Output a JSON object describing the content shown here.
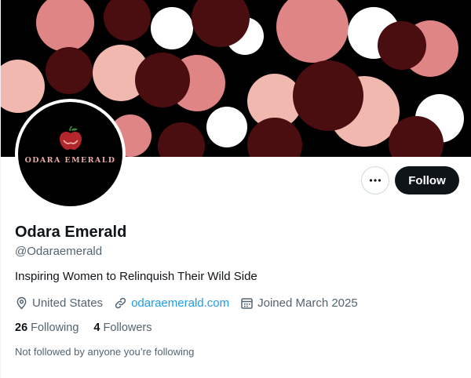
{
  "profile": {
    "display_name": "Odara Emerald",
    "handle": "@Odaraemerald",
    "bio": "Inspiring Women to Relinquish Their Wild Side",
    "avatar_text": "ODARA EMERALD",
    "location": "United States",
    "website": "odaraemerald.com",
    "joined": "Joined March 2025",
    "following_count": "26",
    "following_label": "Following",
    "followers_count": "4",
    "followers_label": "Followers",
    "social_note": "Not followed by anyone you’re following"
  },
  "actions": {
    "follow_label": "Follow",
    "more_icon": "more-horizontal-icon"
  },
  "icons": {
    "location": "location-pin-icon",
    "website": "link-icon",
    "joined": "calendar-icon"
  },
  "colors": {
    "banner_background": "#000000",
    "banner_dark": "#4a0d10",
    "banner_rose": "#e08585",
    "banner_blush": "#f0b8ae",
    "banner_white": "#ffffff",
    "link": "#1d9bf0",
    "follow_button": "#0f1419",
    "secondary_text": "#536471"
  }
}
